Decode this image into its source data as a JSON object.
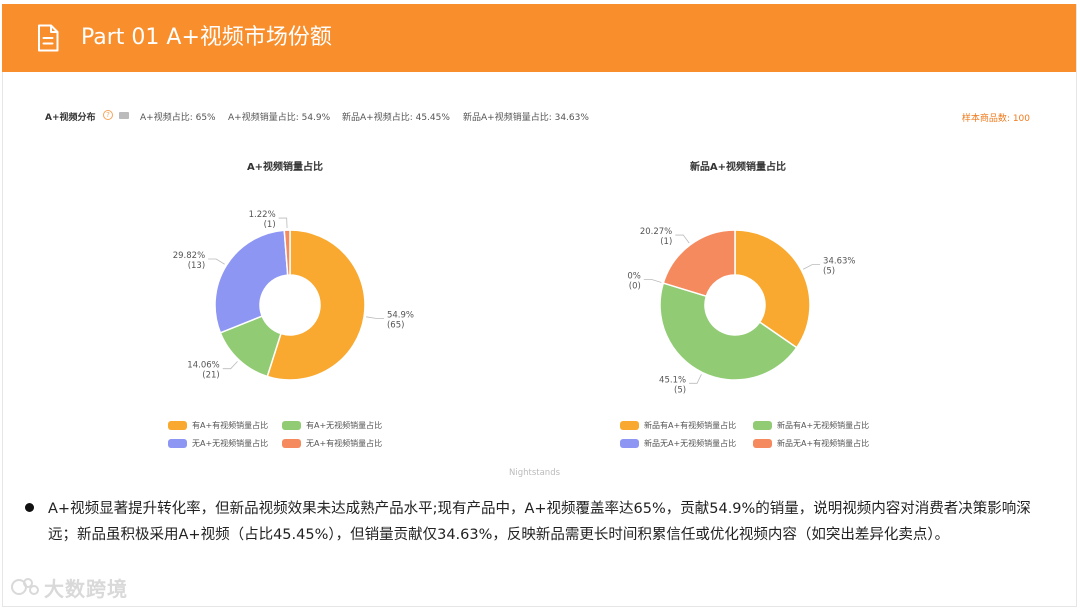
{
  "header": {
    "title": "Part 01  A+视频市场份额"
  },
  "stats": {
    "lead": "A+视频分布",
    "items": [
      "A+视频占比: 65%",
      "A+视频销量占比: 54.9%",
      "新品A+视频占比: 45.45%",
      "新品A+视频销量占比: 34.63%"
    ],
    "sample_count": "样本商品数: 100"
  },
  "chart_data": [
    {
      "type": "pie",
      "donut": true,
      "title": "A+视频销量占比",
      "slices": [
        {
          "name": "有A+有视频销量占比",
          "pct_label": "54.9%",
          "count_label": "(65)",
          "value": 54.9,
          "color": "#f9a92f"
        },
        {
          "name": "有A+无视频销量占比",
          "pct_label": "14.06%",
          "count_label": "(21)",
          "value": 14.06,
          "color": "#91cb74"
        },
        {
          "name": "无A+无视频销量占比",
          "pct_label": "29.82%",
          "count_label": "(13)",
          "value": 29.82,
          "color": "#8e96f4"
        },
        {
          "name": "无A+有视频销量占比",
          "pct_label": "1.22%",
          "count_label": "(1)",
          "value": 1.22,
          "color": "#f58a5e"
        }
      ],
      "legend_position": "bottom"
    },
    {
      "type": "pie",
      "donut": true,
      "title": "新品A+视频销量占比",
      "slices": [
        {
          "name": "新品有A+有视频销量占比",
          "pct_label": "34.63%",
          "count_label": "(5)",
          "value": 34.63,
          "color": "#f9a92f"
        },
        {
          "name": "新品有A+无视频销量占比",
          "pct_label": "45.1%",
          "count_label": "(5)",
          "value": 45.1,
          "color": "#91cb74"
        },
        {
          "name": "新品无A+无视频销量占比",
          "pct_label": "0%",
          "count_label": "(0)",
          "value": 0,
          "color": "#8e96f4"
        },
        {
          "name": "新品无A+有视频销量占比",
          "pct_label": "20.27%",
          "count_label": "(1)",
          "value": 20.27,
          "color": "#f58a5e"
        }
      ],
      "legend_position": "bottom"
    }
  ],
  "footer_note": "Nightstands",
  "bullet": "A+视频显著提升转化率，但新品视频效果未达成熟产品水平;现有产品中，A+视频覆盖率达65%，贡献54.9%的销量，说明视频内容对消费者决策影响深远；新品虽积极采用A+视频（占比45.45%），但销量贡献仅34.63%，反映新品需更长时间积累信任或优化视频内容（如突出差异化卖点）。",
  "watermark": "大数跨境"
}
